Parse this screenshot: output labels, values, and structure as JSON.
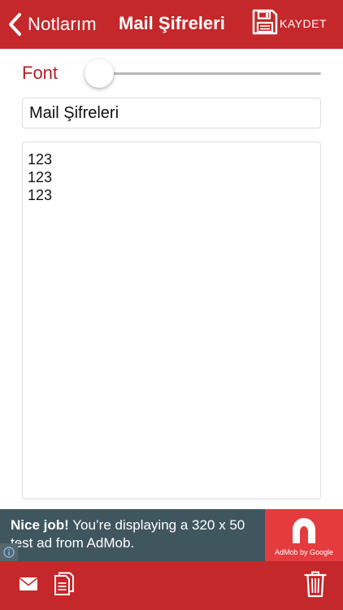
{
  "navbar": {
    "back_label": "Notlarım",
    "title": "Mail Şifreleri",
    "save_label": "KAYDET"
  },
  "font_control": {
    "label": "Font",
    "slider_value": 0.0
  },
  "note": {
    "title_value": "Mail Şifreleri",
    "body_value": "123\n123\n123"
  },
  "ad": {
    "headline": "Nice job!",
    "message": " You’re displaying a 320 x 50 test ad from AdMob.",
    "logo_caption": "AdMob by Google"
  },
  "colors": {
    "brand_red": "#c4282a",
    "label_red": "#b21f24",
    "ad_background": "#3f565e",
    "admob_red": "#e33b3e"
  },
  "icons": {
    "back": "chevron-left-icon",
    "save": "floppy-disk-icon",
    "mail": "envelope-icon",
    "copy": "copy-document-icon",
    "trash": "trash-icon",
    "ad_info": "info-icon"
  }
}
